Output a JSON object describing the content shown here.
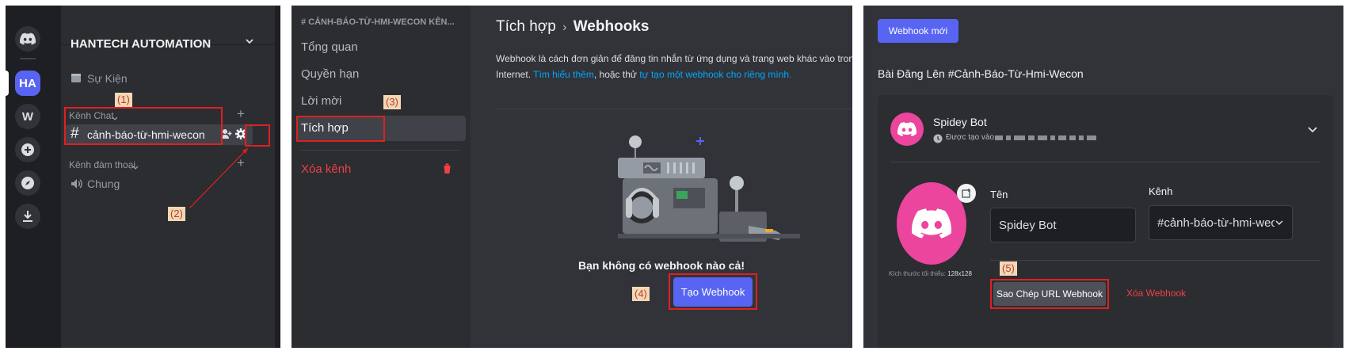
{
  "panel1": {
    "server_name": "HANTECH AUTOMATION",
    "servers": [
      {
        "label": "HA",
        "active": true
      },
      {
        "label": "W",
        "active": false
      }
    ],
    "events_label": "Sự Kiện",
    "text_category": "Kênh Chat",
    "text_channel": "cảnh-báo-từ-hmi-wecon",
    "voice_category": "Kênh đàm thoại",
    "voice_channel": "Chung",
    "annotation_1": "(1)",
    "annotation_2": "(2)"
  },
  "panel2": {
    "channel_header": "# CẢNH-BÁO-TỪ-HMI-WECON KÊN...",
    "nav_items": [
      "Tổng quan",
      "Quyền hạn",
      "Lời mời",
      "Tích hợp"
    ],
    "delete_channel": "Xóa kênh",
    "breadcrumb_parent": "Tích hợp",
    "breadcrumb_current": "Webhooks",
    "description_1": "Webhook là cách đơn giản để đăng tin nhắn từ ứng dụng và trang web khác vào trong",
    "description_2": "Internet. ",
    "learn_more": "Tìm hiểu thêm",
    "or_try": ", hoặc thử ",
    "create_own": "tự tạo một webhook cho riêng mình.",
    "empty_title": "Bạn không có webhook nào cả!",
    "create_button": "Tạo Webhook",
    "annotation_3": "(3)",
    "annotation_4": "(4)"
  },
  "panel3": {
    "new_webhook_button": "Webhook mới",
    "section_title": "Bài Đăng Lên #Cảnh-Báo-Từ-Hmi-Wecon",
    "bot_name": "Spidey Bot",
    "created_label": "Được tạo vào",
    "name_label": "Tên",
    "name_value": "Spidey Bot",
    "channel_label": "Kênh",
    "channel_value": "#cảnh-báo-từ-hmi-wec",
    "min_size_label": "Kích thước tối thiểu:",
    "min_size_value": "128x128",
    "copy_url_button": "Sao Chép URL Webhook",
    "delete_webhook": "Xóa Webhook",
    "annotation_5": "(5)"
  },
  "colors": {
    "blurple": "#5865f2",
    "danger": "#f23f43",
    "link": "#00a8fc",
    "annotation_red": "#e02020",
    "avatar_pink": "#eb459e"
  }
}
